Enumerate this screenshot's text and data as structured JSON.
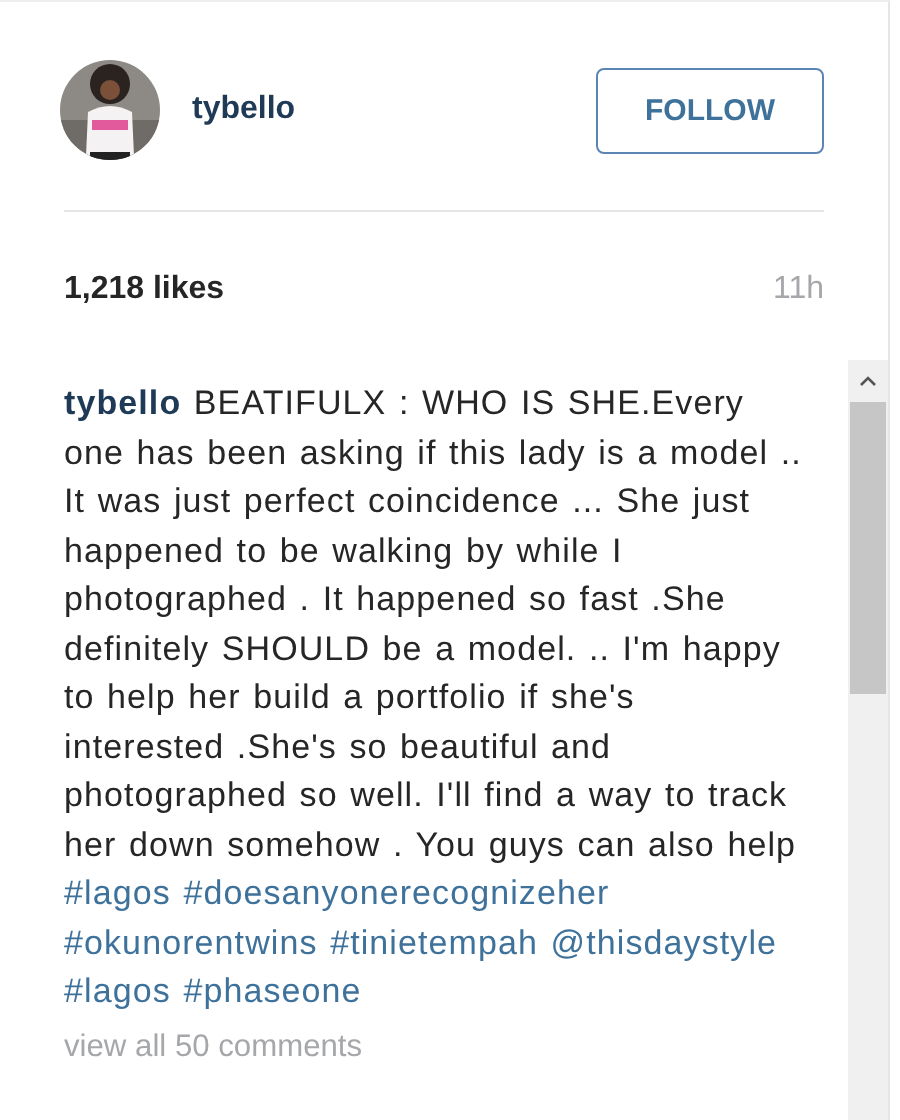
{
  "post": {
    "username": "tybello",
    "follow_button": "FOLLOW",
    "likes": "1,218 likes",
    "time": "11h"
  },
  "caption": [
    {
      "kind": "user",
      "text": "tybello"
    },
    {
      "kind": "text",
      "text": " BEATIFULX : WHO IS SHE.Every one has been asking if this lady is a model .. It was just perfect coincidence ... She just happened to be walking by while I photographed . It happened so fast .She definitely SHOULD be a model. .. I'm happy to help her build a portfolio if she's interested .She's so beautiful and photographed so well. I'll find a way to track her down somehow . You guys can also help "
    },
    {
      "kind": "tag",
      "text": "#lagos"
    },
    {
      "kind": "tag",
      "text": "#doesanyonerecognizeher"
    },
    {
      "kind": "tag",
      "text": "#okunorentwins"
    },
    {
      "kind": "tag",
      "text": "#tinietempah"
    },
    {
      "kind": "tag",
      "text": "@thisdaystyle"
    },
    {
      "kind": "tag",
      "text": "#lagos"
    },
    {
      "kind": "tag",
      "text": "#phaseone"
    }
  ],
  "comments_link": "view all 50 comments"
}
